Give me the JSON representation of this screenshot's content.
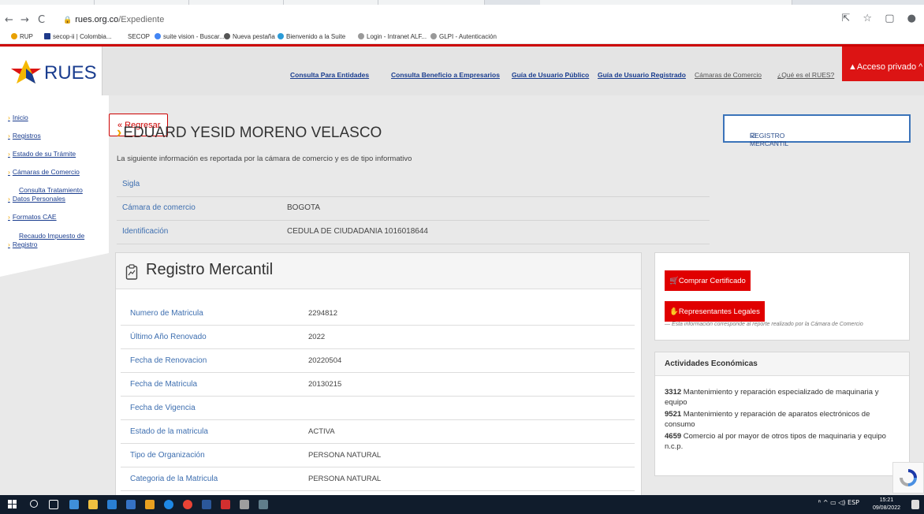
{
  "browser": {
    "url_host": "rues.org.co",
    "url_path": "/Expediente",
    "bookmarks": [
      "RUP",
      "secop-ii | Colombia...",
      "SECOP",
      "suite vision - Buscar...",
      "Nueva pestaña",
      "Bienvenido a la Suite",
      "Login - Intranet ALF...",
      "GLPI - Autenticación"
    ]
  },
  "header": {
    "logo": "RUES",
    "nav": [
      "Consulta Para Entidades",
      "Consulta Beneficio a Empresarios",
      "Guía de Usuario Público",
      "Guía de Usuario Registrado",
      "Cámaras de Comercio",
      "¿Qué es el RUES?"
    ],
    "acceso": "Acceso privado"
  },
  "sidebar": {
    "items": [
      "Inicio",
      "Registros",
      "Estado de su Trámite",
      "Cámaras de Comercio",
      "Consulta Tratamiento",
      "Datos Personales",
      "Formatos CAE",
      "Recaudo Impuesto de",
      "Registro"
    ]
  },
  "main": {
    "back": "« Regresar",
    "name": "EDUARD YESID MORENO VELASCO",
    "registro_box": "REGISTRO MERCANTIL",
    "info_text": "La siguiente información es reportada por la cámara de comercio y es de tipo informativo",
    "rows": [
      {
        "label": "Sigla",
        "value": ""
      },
      {
        "label": "Cámara de comercio",
        "value": "BOGOTA"
      },
      {
        "label": "Identificación",
        "value": "CEDULA DE CIUDADANIA 1016018644"
      }
    ]
  },
  "registro": {
    "title": "Registro Mercantil",
    "rows": [
      {
        "label": "Numero de Matricula",
        "value": "2294812"
      },
      {
        "label": "Último Año Renovado",
        "value": "2022"
      },
      {
        "label": "Fecha de Renovacion",
        "value": "20220504"
      },
      {
        "label": "Fecha de Matricula",
        "value": "20130215"
      },
      {
        "label": "Fecha de Vigencia",
        "value": ""
      },
      {
        "label": "Estado de la matricula",
        "value": "ACTIVA"
      },
      {
        "label": "Tipo de Organización",
        "value": "PERSONA NATURAL"
      },
      {
        "label": "Categoria de la Matricula",
        "value": "PERSONA NATURAL"
      }
    ]
  },
  "side_panel": {
    "btn_certificado": "Comprar Certificado",
    "btn_representantes": "Representantes Legales",
    "note": "— Esta información corresponde al reporte realizado por la Cámara de Comercio",
    "actividades_title": "Actividades Económicas",
    "actividades": [
      {
        "code": "3312",
        "text": "Mantenimiento y reparación especializado de maquinaria y equipo"
      },
      {
        "code": "9521",
        "text": "Mantenimiento y reparación de aparatos electrónicos de consumo"
      },
      {
        "code": "4659",
        "text": "Comercio al por mayor de otros tipos de maquinaria y equipo n.c.p."
      }
    ]
  },
  "taskbar": {
    "lang": "ESP",
    "time": "15:21",
    "date": "09/08/2022"
  },
  "colors": {
    "brand_red": "#dc1414",
    "brand_blue": "#1a3d8f",
    "accent_yellow": "#f0a500"
  }
}
